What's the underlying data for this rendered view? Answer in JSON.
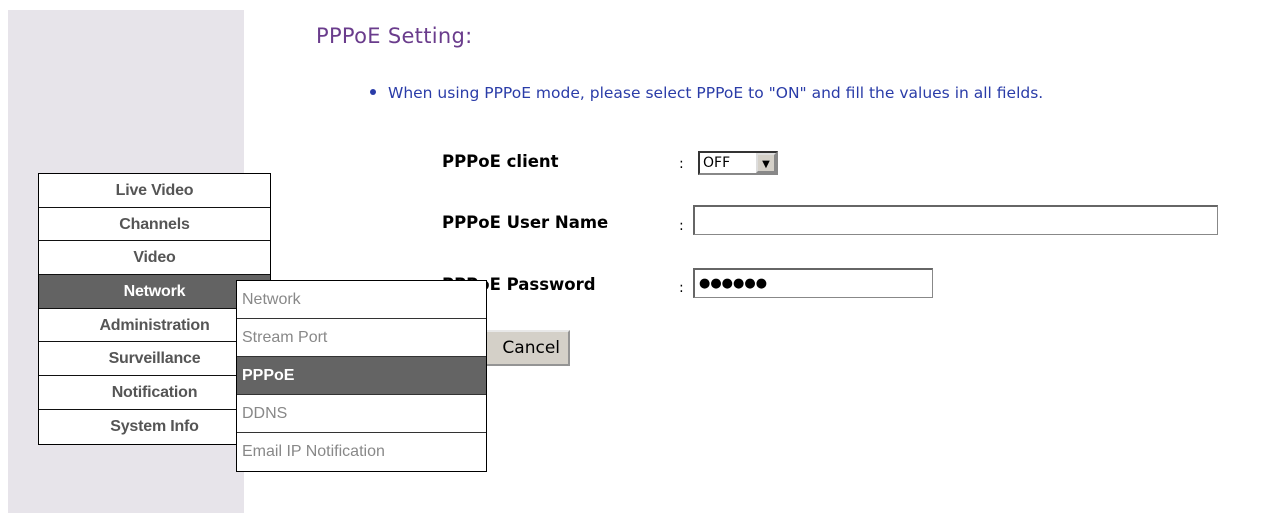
{
  "page": {
    "title": "PPPoE Setting:",
    "instruction": "When using PPPoE mode, please select PPPoE to \"ON\" and fill the values in all fields."
  },
  "main_menu": {
    "items": [
      {
        "label": "Live Video"
      },
      {
        "label": "Channels"
      },
      {
        "label": "Video"
      },
      {
        "label": "Network",
        "active": true
      },
      {
        "label": "Administration"
      },
      {
        "label": "Surveillance"
      },
      {
        "label": "Notification"
      },
      {
        "label": "System Info"
      }
    ]
  },
  "sub_menu": {
    "items": [
      {
        "label": "Network"
      },
      {
        "label": "Stream Port"
      },
      {
        "label": "PPPoE",
        "active": true
      },
      {
        "label": "DDNS"
      },
      {
        "label": "Email IP Notification"
      }
    ]
  },
  "form": {
    "client_label": "PPPoE client",
    "client_value": "OFF",
    "username_label": "PPPoE User Name",
    "username_value": "",
    "password_label": "PPPoE Password",
    "password_mask": "●●●●●●",
    "colon": ":"
  },
  "buttons": {
    "cancel": "Cancel"
  },
  "colors": {
    "title": "#6a3c8c",
    "instruction": "#2a3ca8",
    "active_menu": "#636363",
    "panel_bg": "#e7e4ea"
  }
}
